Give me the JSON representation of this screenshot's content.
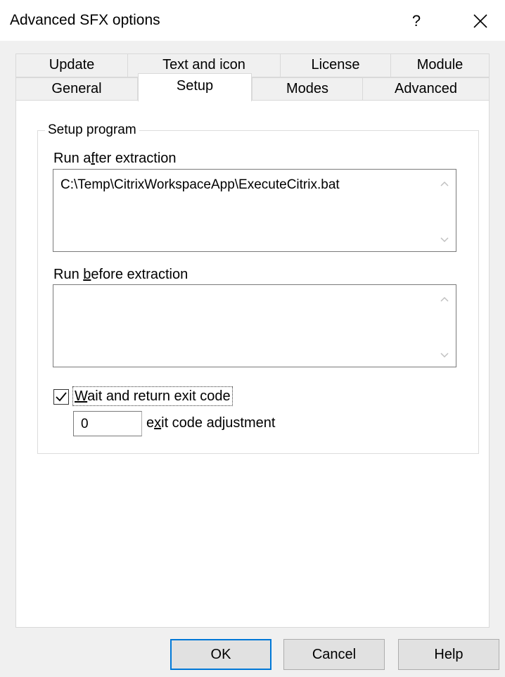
{
  "window": {
    "title": "Advanced SFX options",
    "help_glyph": "?",
    "close_icon": "close-icon"
  },
  "tabs": {
    "row_back": [
      "Update",
      "Text and icon",
      "License",
      "Module"
    ],
    "row_front": [
      "General",
      "Setup",
      "Modes",
      "Advanced"
    ],
    "active": "Setup"
  },
  "setup": {
    "group_title": "Setup program",
    "run_after": {
      "label_pre": "Run a",
      "label_mnemonic": "f",
      "label_post": "ter extraction",
      "value": "C:\\Temp\\CitrixWorkspaceApp\\ExecuteCitrix.bat"
    },
    "run_before": {
      "label_pre": "Run ",
      "label_mnemonic": "b",
      "label_post": "efore extraction",
      "value": ""
    },
    "wait": {
      "checked": true,
      "label_mnemonic": "W",
      "label_post": "ait and return exit code"
    },
    "exit_adjust": {
      "value": "0",
      "label_pre": "e",
      "label_mnemonic": "x",
      "label_post": "it code adjustment"
    }
  },
  "buttons": {
    "ok": "OK",
    "cancel": "Cancel",
    "help": "Help"
  },
  "colors": {
    "accent": "#0078d7",
    "dialog_bg": "#f0f0f0",
    "panel_bg": "#ffffff"
  }
}
